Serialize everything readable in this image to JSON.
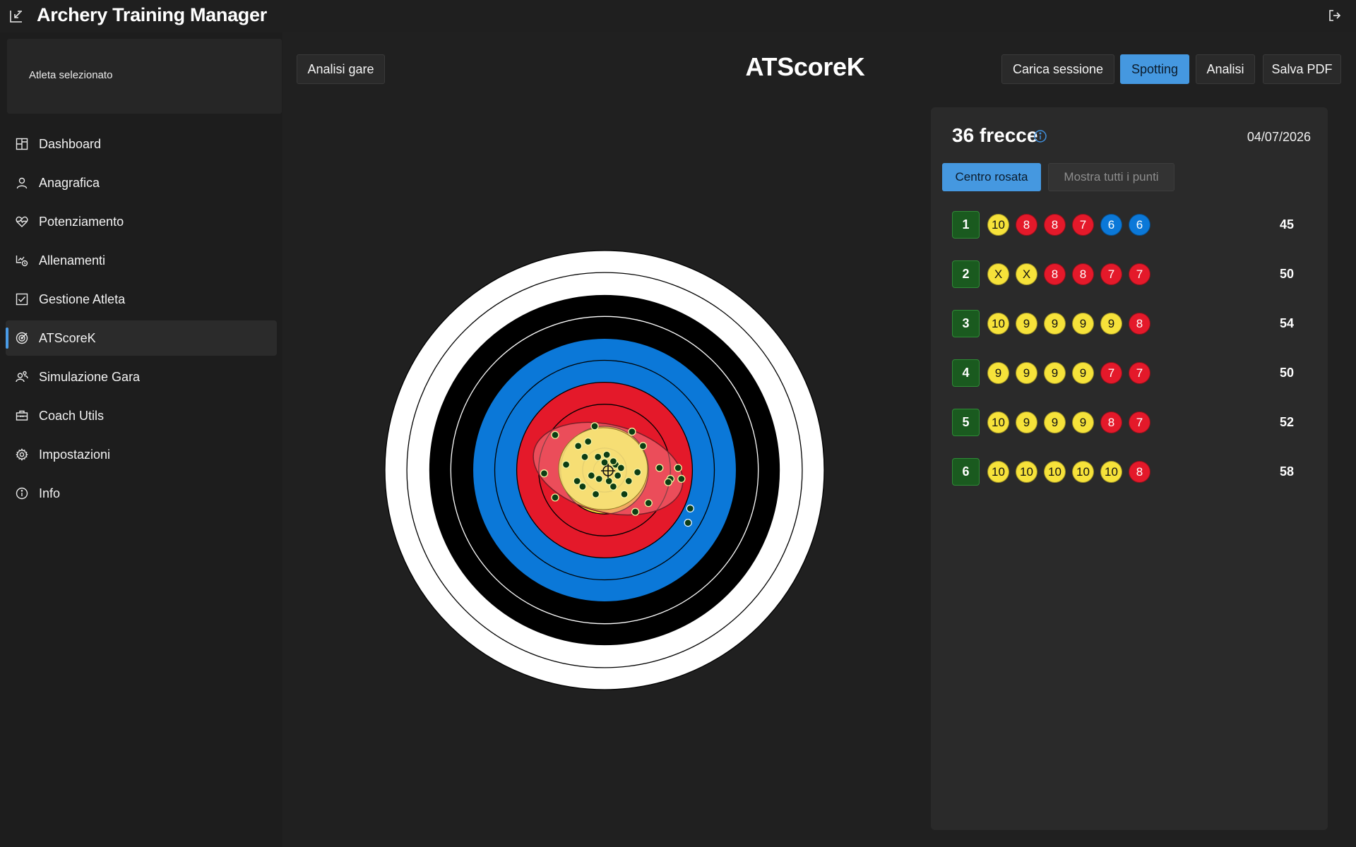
{
  "app": {
    "title": "Archery Training Manager"
  },
  "sidebar": {
    "athlete_label": "Atleta selezionato",
    "items": [
      {
        "label": "Dashboard",
        "icon": "dashboard-icon"
      },
      {
        "label": "Anagrafica",
        "icon": "user-icon"
      },
      {
        "label": "Potenziamento",
        "icon": "heart-pulse-icon"
      },
      {
        "label": "Allenamenti",
        "icon": "training-icon"
      },
      {
        "label": "Gestione Atleta",
        "icon": "checkbox-icon"
      },
      {
        "label": "ATScoreK",
        "icon": "target-icon",
        "active": true
      },
      {
        "label": "Simulazione Gara",
        "icon": "athletes-icon"
      },
      {
        "label": "Coach Utils",
        "icon": "toolbox-icon"
      },
      {
        "label": "Impostazioni",
        "icon": "gear-icon"
      },
      {
        "label": "Info",
        "icon": "info-icon"
      }
    ]
  },
  "toolbar": {
    "analisi_gare": "Analisi gare",
    "carica_sessione": "Carica sessione",
    "spotting": "Spotting",
    "analisi": "Analisi",
    "salva_pdf": "Salva PDF"
  },
  "page_title": "ATScoreK",
  "panel": {
    "arrow_count": "36 frecce",
    "date": "04/07/2026",
    "toggle_on": "Centro rosata",
    "toggle_off": "Mostra tutti i punti",
    "ends": [
      {
        "num": "1",
        "arrows": [
          "10",
          "8",
          "8",
          "7",
          "6",
          "6"
        ],
        "total": "45"
      },
      {
        "num": "2",
        "arrows": [
          "X",
          "X",
          "8",
          "8",
          "7",
          "7"
        ],
        "total": "50"
      },
      {
        "num": "3",
        "arrows": [
          "10",
          "9",
          "9",
          "9",
          "9",
          "8"
        ],
        "total": "54"
      },
      {
        "num": "4",
        "arrows": [
          "9",
          "9",
          "9",
          "9",
          "7",
          "7"
        ],
        "total": "50"
      },
      {
        "num": "5",
        "arrows": [
          "10",
          "9",
          "9",
          "9",
          "8",
          "7"
        ],
        "total": "52"
      },
      {
        "num": "6",
        "arrows": [
          "10",
          "10",
          "10",
          "10",
          "10",
          "8"
        ],
        "total": "58"
      }
    ]
  },
  "colors": {
    "accent": "#4598e0",
    "gold": "#f6e23a",
    "red": "#e4192a",
    "blue": "#0b78d8",
    "black": "#000000",
    "white": "#ffffff",
    "end_badge": "#1a5a1f"
  },
  "target": {
    "hits": [
      [
        0.3,
        0.02
      ],
      [
        0.1,
        -0.05
      ],
      [
        -0.05,
        0.08
      ],
      [
        0.08,
        0.15
      ],
      [
        -0.12,
        0.05
      ],
      [
        0.15,
        -0.02
      ],
      [
        0.02,
        -0.14
      ],
      [
        -0.18,
        -0.12
      ],
      [
        0.22,
        0.1
      ],
      [
        -0.25,
        0.1
      ],
      [
        0.18,
        0.22
      ],
      [
        -0.08,
        0.22
      ],
      [
        0.25,
        -0.35
      ],
      [
        -0.09,
        -0.4
      ],
      [
        0.35,
        -0.22
      ],
      [
        -0.45,
        -0.32
      ],
      [
        -0.24,
        -0.22
      ],
      [
        -0.15,
        -0.26
      ],
      [
        -0.45,
        0.25
      ],
      [
        -0.35,
        -0.05
      ],
      [
        -0.55,
        0.03
      ],
      [
        0.28,
        0.38
      ],
      [
        0.4,
        0.3
      ],
      [
        0.5,
        -0.02
      ],
      [
        0.6,
        0.08
      ],
      [
        0.58,
        0.11
      ],
      [
        0.67,
        -0.02
      ],
      [
        0.7,
        0.08
      ],
      [
        -0.2,
        0.15
      ],
      [
        0.04,
        0.1
      ],
      [
        0.12,
        0.05
      ],
      [
        0.0,
        -0.07
      ],
      [
        -0.06,
        -0.12
      ],
      [
        0.08,
        -0.08
      ],
      [
        0.78,
        0.35
      ],
      [
        0.76,
        0.48
      ]
    ],
    "hits_blue": [
      [
        0.78,
        0.35
      ],
      [
        0.76,
        0.48
      ]
    ]
  }
}
